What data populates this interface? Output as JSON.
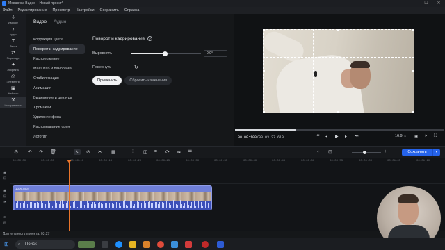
{
  "window": {
    "title": "Мовавика Видео – Новый проект*",
    "controls": [
      "—",
      "☐",
      "✕"
    ]
  },
  "menu": [
    "Файл",
    "Редактирование",
    "Просмотр",
    "Настройки",
    "Сохранить",
    "Справка"
  ],
  "tools": [
    {
      "icon": "⇩",
      "label": "Импорт"
    },
    {
      "icon": "♪",
      "label": "Аудио"
    },
    {
      "icon": "T",
      "label": "Текст"
    },
    {
      "icon": "⇄",
      "label": "Переходы"
    },
    {
      "icon": "✦",
      "label": "Эффекты"
    },
    {
      "icon": "◎",
      "label": "Элементы"
    },
    {
      "icon": "▣",
      "label": "Наборы"
    },
    {
      "icon": "⚒",
      "label": "Инструменты"
    }
  ],
  "panel": {
    "tabs": [
      "Видео",
      "Аудио"
    ],
    "list": [
      "Коррекция цвета",
      "Поворот и кадрирование",
      "Расположение",
      "Масштаб и панорама",
      "Стабилизация",
      "Анимация",
      "Выделение и цензура",
      "Хромакей",
      "Удаление фона",
      "Распознавание сцен",
      "Логотип"
    ],
    "selected_index": 1,
    "editor_title": "Поворот и кадрирование",
    "align_label": "Выровнять",
    "align_value": "0,0°",
    "align_slider_fraction": 0.48,
    "rotate_label": "Повернуть",
    "apply_label": "Применить",
    "reset_label": "Сбросить изменения"
  },
  "player": {
    "current": "00:00:100",
    "total": "/00:03:27.610",
    "ratio": "16:9 ⌄",
    "progress_fraction": 0.29
  },
  "toolbar": {
    "save_label": "Сохранить"
  },
  "ruler": [
    "00:00:00",
    "00:00:05",
    "00:00:10",
    "00:00:15",
    "00:00:20",
    "00:00:25",
    "00:00:30",
    "00:00:35",
    "00:00:40",
    "00:00:45",
    "00:00:50",
    "00:00:55",
    "00:01:00",
    "00:01:05",
    "00:01:10"
  ],
  "clip": {
    "name": "1006.mp4"
  },
  "status": {
    "duration": "Длительность проекта: 03:27"
  },
  "taskbar": {
    "search_placeholder": "Поиск"
  }
}
